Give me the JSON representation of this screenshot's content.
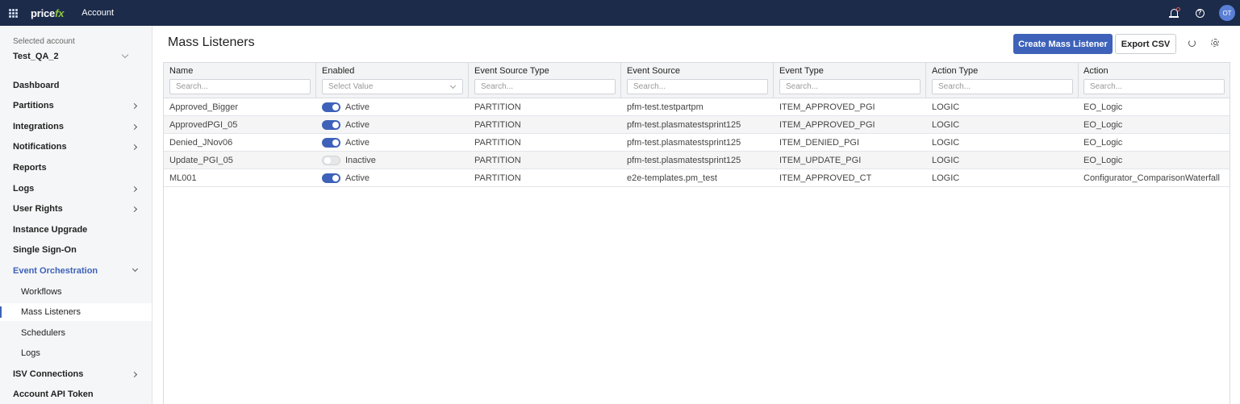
{
  "header": {
    "logo_main": "price",
    "logo_accent": "fx",
    "app_title": "Account",
    "avatar_initials": "OT"
  },
  "sidebar": {
    "account_label": "Selected account",
    "account_value": "Test_QA_2",
    "items": [
      {
        "label": "Dashboard"
      },
      {
        "label": "Partitions"
      },
      {
        "label": "Integrations"
      },
      {
        "label": "Notifications"
      },
      {
        "label": "Reports"
      },
      {
        "label": "Logs"
      },
      {
        "label": "User Rights"
      },
      {
        "label": "Instance Upgrade"
      },
      {
        "label": "Single Sign-On"
      },
      {
        "label": "Event Orchestration"
      },
      {
        "label": "Workflows"
      },
      {
        "label": "Mass Listeners"
      },
      {
        "label": "Schedulers"
      },
      {
        "label": "Logs"
      },
      {
        "label": "ISV Connections"
      },
      {
        "label": "Account API Token"
      }
    ]
  },
  "main": {
    "title": "Mass Listeners",
    "create_button": "Create Mass Listener",
    "export_button": "Export CSV"
  },
  "table": {
    "columns": [
      {
        "label": "Name",
        "filter": "Search..."
      },
      {
        "label": "Enabled",
        "filter": "Select Value"
      },
      {
        "label": "Event Source Type",
        "filter": "Search..."
      },
      {
        "label": "Event Source",
        "filter": "Search..."
      },
      {
        "label": "Event Type",
        "filter": "Search..."
      },
      {
        "label": "Action Type",
        "filter": "Search..."
      },
      {
        "label": "Action",
        "filter": "Search..."
      }
    ],
    "rows": [
      {
        "name": "Approved_Bigger",
        "enabled": true,
        "status": "Active",
        "source_type": "PARTITION",
        "source": "pfm-test.testpartpm",
        "event_type": "ITEM_APPROVED_PGI",
        "action_type": "LOGIC",
        "action": "EO_Logic"
      },
      {
        "name": "ApprovedPGI_05",
        "enabled": true,
        "status": "Active",
        "source_type": "PARTITION",
        "source": "pfm-test.plasmatestsprint125",
        "event_type": "ITEM_APPROVED_PGI",
        "action_type": "LOGIC",
        "action": "EO_Logic"
      },
      {
        "name": "Denied_JNov06",
        "enabled": true,
        "status": "Active",
        "source_type": "PARTITION",
        "source": "pfm-test.plasmatestsprint125",
        "event_type": "ITEM_DENIED_PGI",
        "action_type": "LOGIC",
        "action": "EO_Logic"
      },
      {
        "name": "Update_PGI_05",
        "enabled": false,
        "status": "Inactive",
        "source_type": "PARTITION",
        "source": "pfm-test.plasmatestsprint125",
        "event_type": "ITEM_UPDATE_PGI",
        "action_type": "LOGIC",
        "action": "EO_Logic"
      },
      {
        "name": "ML001",
        "enabled": true,
        "status": "Active",
        "source_type": "PARTITION",
        "source": "e2e-templates.pm_test",
        "event_type": "ITEM_APPROVED_CT",
        "action_type": "LOGIC",
        "action": "Configurator_ComparisonWaterfall"
      }
    ]
  }
}
